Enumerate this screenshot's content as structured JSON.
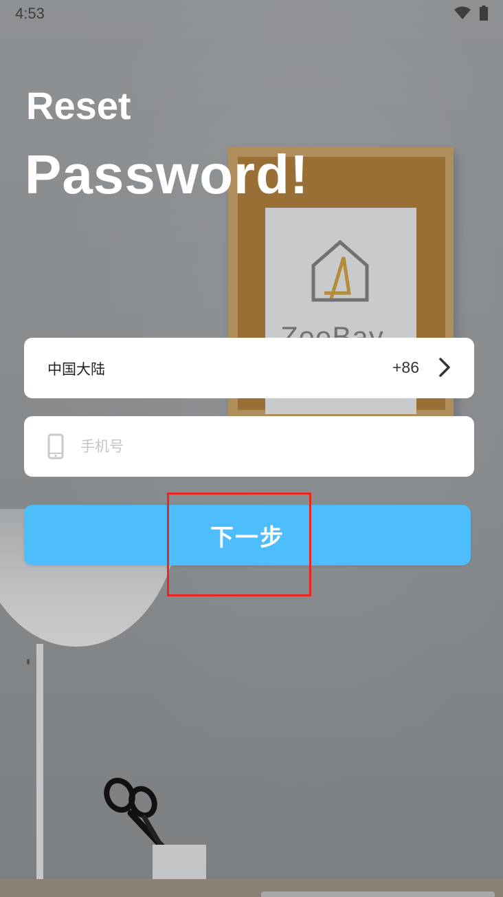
{
  "status_bar": {
    "time": "4:53",
    "icons": [
      "wifi-icon",
      "battery-icon"
    ]
  },
  "header": {
    "title_line1": "Reset",
    "title_line2": "Password!"
  },
  "background": {
    "poster_text": "ZeeBay"
  },
  "form": {
    "region": {
      "name": "中国大陆",
      "code": "+86",
      "icon": "chevron-right-icon"
    },
    "phone": {
      "placeholder": "手机号",
      "value": "",
      "icon": "phone-icon"
    },
    "next_button_label": "下一步"
  },
  "colors": {
    "accent": "#4dbdfc",
    "highlight": "#e8281f",
    "card": "#ffffff",
    "title_text": "#ffffff"
  }
}
